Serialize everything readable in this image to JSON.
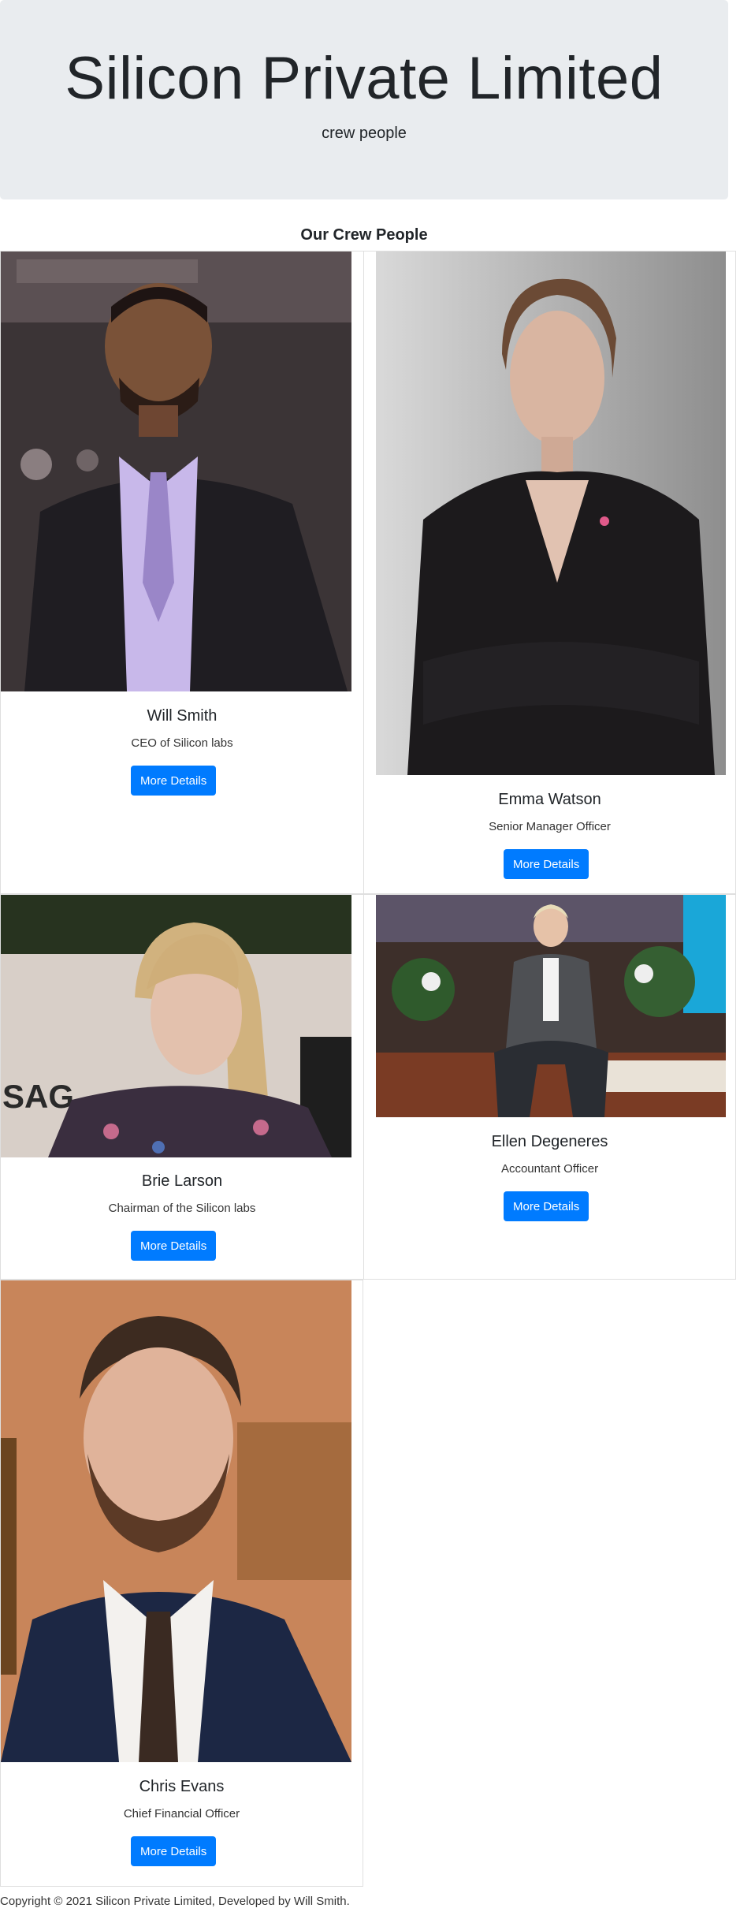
{
  "header": {
    "title": "Silicon Private Limited",
    "subtitle": "crew people"
  },
  "section": {
    "title": "Our Crew People"
  },
  "cards": [
    {
      "name": "Will Smith",
      "role": "CEO of Silicon labs",
      "button": "More Details"
    },
    {
      "name": "Emma Watson",
      "role": "Senior Manager Officer",
      "button": "More Details"
    },
    {
      "name": "Brie Larson",
      "role": "Chairman of the Silicon labs",
      "button": "More Details"
    },
    {
      "name": "Ellen Degeneres",
      "role": "Accountant Officer",
      "button": "More Details"
    },
    {
      "name": "Chris Evans",
      "role": "Chief Financial Officer",
      "button": "More Details"
    }
  ],
  "footer": {
    "text": "Copyright © 2021 Silicon Private Limited, Developed by Will Smith."
  },
  "colors": {
    "jumbotron": "#e9ecef",
    "button": "#007bff",
    "card_border": "#dfdfdf"
  }
}
